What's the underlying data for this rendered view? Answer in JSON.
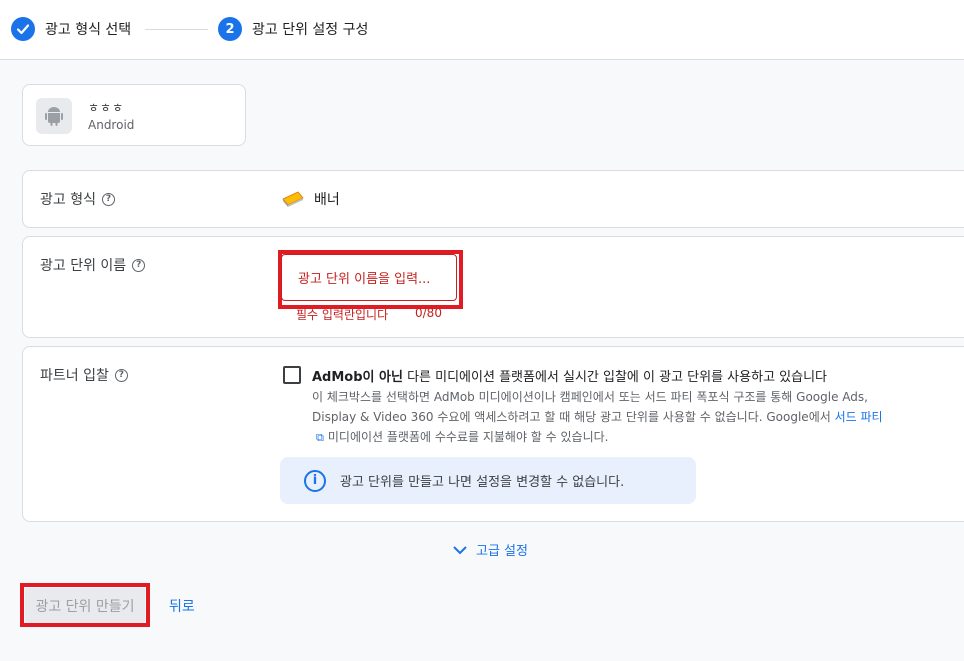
{
  "stepper": {
    "step1_label": "광고 형식 선택",
    "step2_number": "2",
    "step2_label": "광고 단위 설정 구성"
  },
  "app": {
    "name": "ㅎㅎㅎ",
    "platform": "Android"
  },
  "ad_format": {
    "label": "광고 형식",
    "value": "배너"
  },
  "ad_unit_name": {
    "label": "광고 단위 이름",
    "placeholder": "광고 단위 이름을 입력...",
    "error": "필수 입력란입니다",
    "counter": "0/80"
  },
  "partner_bidding": {
    "label": "파트너 입찰",
    "checkbox_title_bold": "AdMob이 아닌",
    "checkbox_title_rest": " 다른 미디에이션 플랫폼에서 실시간 입찰에 이 광고 단위를 사용하고 있습니다",
    "desc_line1": "이 체크박스를 선택하면 AdMob 미디에이션이나 캠페인에서 또는 서드 파티 폭포식 구조를 통해 Google Ads,",
    "desc_line2_pre": "Display & Video 360 수요에 액세스하려고 할 때 해당 광고 단위를 사용할 수 없습니다. Google에서 ",
    "desc_link": "서드 파티",
    "desc_line3": "미디에이션 플랫폼에 수수료를 지불해야 할 수 있습니다.",
    "info_text": "광고 단위를 만들고 나면 설정을 변경할 수 없습니다."
  },
  "advanced_settings": "고급 설정",
  "actions": {
    "create": "광고 단위 만들기",
    "back": "뒤로"
  },
  "colors": {
    "accent": "#1a73e8",
    "error": "#c5221f",
    "highlight": "#e01b24"
  }
}
